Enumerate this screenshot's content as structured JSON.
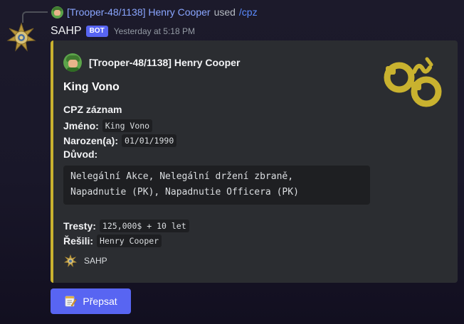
{
  "reply": {
    "author": "[Trooper-48/1138] Henry Cooper",
    "used_text": "used",
    "command": "/cpz"
  },
  "message": {
    "bot_name": "SAHP",
    "bot_badge": "BOT",
    "timestamp": "Yesterday at 5:18 PM"
  },
  "embed": {
    "accent_color": "#c9b22f",
    "author": "[Trooper-48/1138] Henry Cooper",
    "title": "King Vono",
    "thumbnail_icon": "handcuffs-icon",
    "section_heading": "CPZ záznam",
    "fields": {
      "name_label": "Jméno:",
      "name_value": "King Vono",
      "born_label": "Narozen(a):",
      "born_value": "01/01/1990",
      "reason_label": "Důvod:",
      "reason_lines": [
        "Nelegální Akce, Nelegální držení zbraně,",
        "Napadnutie (PK), Napadnutie Officera (PK)"
      ],
      "penalty_label": "Tresty:",
      "penalty_value": "125,000$ + 10 let",
      "handled_label": "Řešili:",
      "handled_value": "Henry Cooper"
    },
    "footer_text": "SAHP"
  },
  "button": {
    "icon": "memo-icon",
    "label": "Přepsat"
  }
}
